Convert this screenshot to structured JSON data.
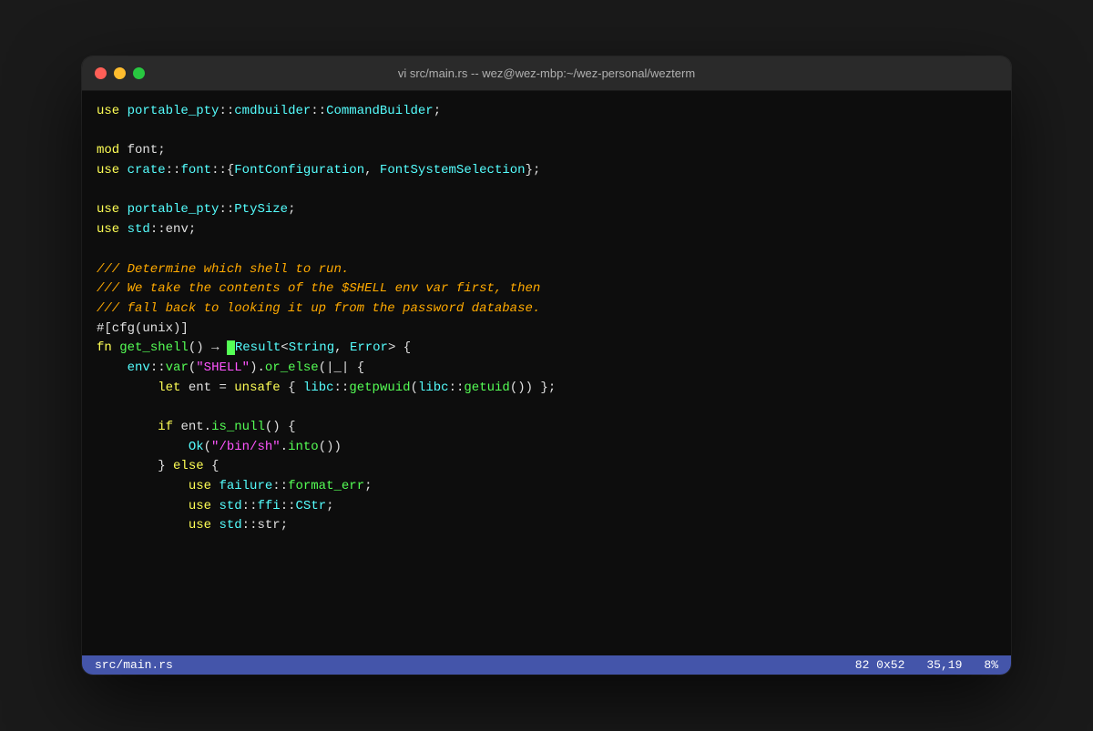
{
  "titlebar": {
    "title": "vi src/main.rs -- wez@wez-mbp:~/wez-personal/wezterm",
    "traffic_lights": [
      "close",
      "minimize",
      "maximize"
    ]
  },
  "statusbar": {
    "filename": "src/main.rs",
    "line_info": "82 0x52",
    "position": "35,19",
    "percent": "8%"
  },
  "code_lines": [
    "use portable_pty::cmdbuilder::CommandBuilder;",
    "",
    "mod font;",
    "use crate::font::{FontConfiguration, FontSystemSelection};",
    "",
    "use portable_pty::PtySize;",
    "use std::env;",
    "",
    "/// Determine which shell to run.",
    "/// We take the contents of the $SHELL env var first, then",
    "/// fall back to looking it up from the password database.",
    "#[cfg(unix)]",
    "fn get_shell() → Result<String, Error> {",
    "    env::var(\"SHELL\").or_else(|_| {",
    "        let ent = unsafe { libc::getpwuid(libc::getuid()) };",
    "",
    "        if ent.is_null() {",
    "            Ok(\"/bin/sh\".into())",
    "        } else {",
    "            use failure::format_err;",
    "            use std::ffi::CStr;",
    "            use std::str;"
  ]
}
